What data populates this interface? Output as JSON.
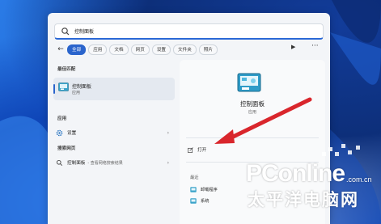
{
  "search": {
    "value": "控制面板"
  },
  "filters": {
    "tabs": [
      {
        "label": "全部",
        "active": true
      },
      {
        "label": "应用",
        "active": false
      },
      {
        "label": "文档",
        "active": false
      },
      {
        "label": "网页",
        "active": false
      },
      {
        "label": "设置",
        "active": false
      },
      {
        "label": "文件夹",
        "active": false
      },
      {
        "label": "照片",
        "active": false
      }
    ],
    "play_icon": "play-icon",
    "more_icon": "more-icon"
  },
  "left": {
    "best_match_heading": "最佳匹配",
    "best_match": {
      "name": "控制面板",
      "type": "应用"
    },
    "apps_heading": "应用",
    "apps": [
      {
        "name": "设置",
        "icon": "gear-icon"
      }
    ],
    "web_heading": "搜索网页",
    "web": [
      {
        "name": "控制面板",
        "extra": "- 查看网络搜索结果",
        "icon": "search-icon"
      }
    ]
  },
  "right": {
    "title": "控制面板",
    "subtitle": "应用",
    "open_label": "打开",
    "recent_heading": "最近",
    "recent": [
      {
        "name": "卸载程序"
      },
      {
        "name": "系统"
      }
    ]
  },
  "watermark": {
    "brand": "PConline",
    "domain": ".com.cn",
    "chinese": "太平洋电脑网"
  },
  "colors": {
    "accent": "#2a64cc",
    "arrow": "#d9262c"
  }
}
